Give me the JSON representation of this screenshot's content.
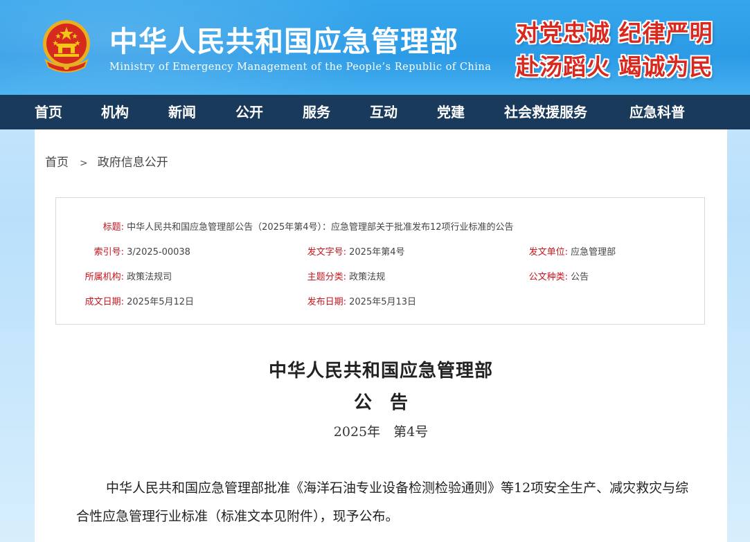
{
  "header": {
    "title": "中华人民共和国应急管理部",
    "subtitle": "Ministry of Emergency Management of the People’s Republic of China",
    "slogan_line1": "对党忠诚 纪律严明",
    "slogan_line2": "赴汤蹈火 竭诚为民",
    "emblem_icon": "national-emblem-icon"
  },
  "nav": {
    "items": [
      "首页",
      "机构",
      "新闻",
      "公开",
      "服务",
      "互动",
      "党建",
      "社会救援服务",
      "应急科普"
    ]
  },
  "breadcrumb": {
    "home": "首页",
    "separator": ">",
    "current": "政府信息公开"
  },
  "meta": {
    "title_label": "标题:",
    "title_value": "中华人民共和国应急管理部公告（2025年第4号）：应急管理部关于批准发布12项行业标准的公告",
    "index_label": "索引号:",
    "index_value": "3/2025-00038",
    "docnum_label": "发文字号:",
    "docnum_value": "2025年第4号",
    "issuer_label": "发文单位:",
    "issuer_value": "应急管理部",
    "dept_label": "所属机构:",
    "dept_value": "政策法规司",
    "topic_label": "主题分类:",
    "topic_value": "政策法规",
    "type_label": "公文种类:",
    "type_value": "公告",
    "created_label": "成文日期:",
    "created_value": "2025年5月12日",
    "published_label": "发布日期:",
    "published_value": "2025年5月13日"
  },
  "document": {
    "org": "中华人民共和国应急管理部",
    "kind": "公　告",
    "number": "2025年　第4号",
    "paragraph": "中华人民共和国应急管理部批准《海洋石油专业设备检测检验通则》等12项安全生产、减灾救灾与综合性应急管理行业标准（标准文本见附件），现予公布。"
  },
  "colors": {
    "header_blue": "#2c9be6",
    "nav_navy": "#1a3a5c",
    "label_red": "#c4161c",
    "slogan_red": "#d9281e"
  }
}
